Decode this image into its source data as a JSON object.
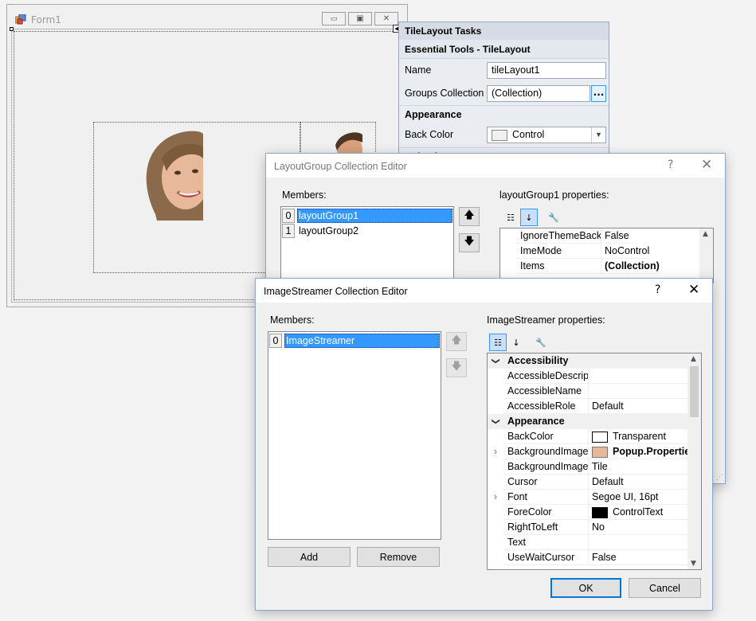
{
  "form1": {
    "title": "Form1",
    "minimize_glyph": "▭",
    "maximize_glyph": "▣",
    "close_glyph": "✕"
  },
  "tasks_panel": {
    "header": "TileLayout Tasks",
    "subheader": "Essential Tools - TileLayout",
    "name_label": "Name",
    "name_value": "tileLayout1",
    "groups_label": "Groups Collection",
    "groups_value": "(Collection)",
    "ellipsis": "...",
    "appearance_header": "Appearance",
    "backcolor_label": "Back Color",
    "backcolor_value": "Control",
    "cut_header": "Behavior"
  },
  "layout_group_editor": {
    "title": "LayoutGroup Collection Editor",
    "help": "?",
    "close": "✕",
    "members_label": "Members:",
    "members": [
      {
        "index": "0",
        "name": "layoutGroup1",
        "selected": true
      },
      {
        "index": "1",
        "name": "layoutGroup2",
        "selected": false
      }
    ],
    "properties_label": "layoutGroup1 properties:",
    "up_glyph": "🡅",
    "down_glyph": "🡇",
    "grid_rows": [
      {
        "name": "IgnoreThemeBackg",
        "value": "False",
        "bold": false
      },
      {
        "name": "ImeMode",
        "value": "NoControl",
        "bold": false
      },
      {
        "name": "Items",
        "value": "(Collection)",
        "bold": true
      }
    ]
  },
  "image_streamer_editor": {
    "title": "ImageStreamer Collection Editor",
    "help": "?",
    "close": "✕",
    "members_label": "Members:",
    "members": [
      {
        "index": "0",
        "name": "ImageStreamer",
        "selected": true
      }
    ],
    "properties_label": "ImageStreamer properties:",
    "up_glyph": "🡅",
    "down_glyph": "🡇",
    "add_label": "Add",
    "remove_label": "Remove",
    "ok_label": "OK",
    "cancel_label": "Cancel",
    "grid_rows": [
      {
        "type": "category",
        "name": "Accessibility",
        "expander": "❯"
      },
      {
        "type": "prop",
        "name": "AccessibleDescript",
        "value": ""
      },
      {
        "type": "prop",
        "name": "AccessibleName",
        "value": ""
      },
      {
        "type": "prop",
        "name": "AccessibleRole",
        "value": "Default"
      },
      {
        "type": "category",
        "name": "Appearance",
        "expander": "❯"
      },
      {
        "type": "prop",
        "name": "BackColor",
        "value": "Transparent",
        "swatch": "#ffffff"
      },
      {
        "type": "prop",
        "name": "BackgroundImage",
        "value": "Popup.Properties",
        "thumb": true,
        "bold": true,
        "expander": "›"
      },
      {
        "type": "prop",
        "name": "BackgroundImageL",
        "value": "Tile"
      },
      {
        "type": "prop",
        "name": "Cursor",
        "value": "Default"
      },
      {
        "type": "prop",
        "name": "Font",
        "value": "Segoe UI, 16pt",
        "expander": "›"
      },
      {
        "type": "prop",
        "name": "ForeColor",
        "value": "ControlText",
        "swatch": "#000000"
      },
      {
        "type": "prop",
        "name": "RightToLeft",
        "value": "No"
      },
      {
        "type": "prop",
        "name": "Text",
        "value": ""
      },
      {
        "type": "prop",
        "name": "UseWaitCursor",
        "value": "False"
      }
    ]
  },
  "colors": {
    "selection": "#3399ff",
    "dialog_border": "#8aa8c9",
    "default_button_border": "#0078d7"
  }
}
